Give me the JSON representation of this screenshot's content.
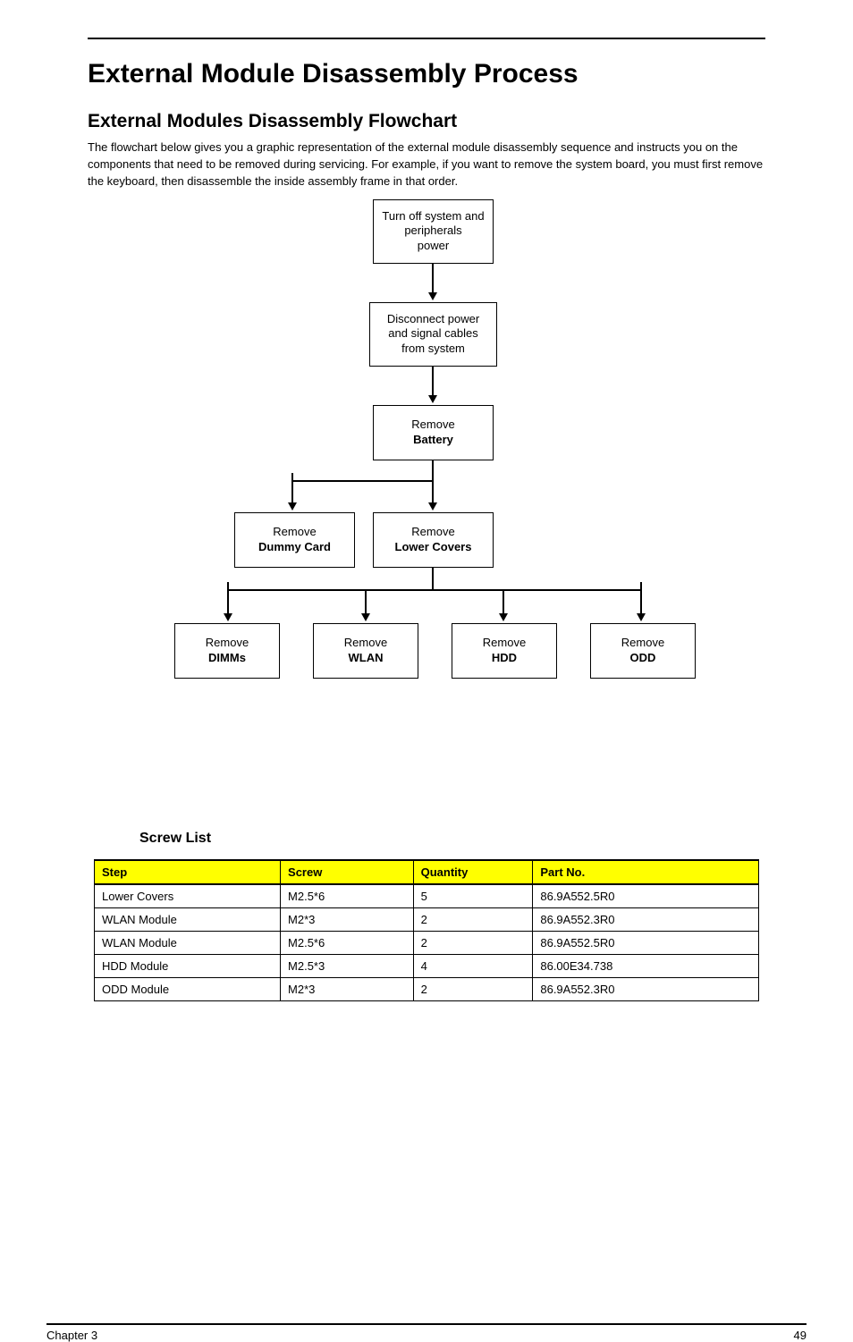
{
  "page": {
    "heading1": "External Module Disassembly Process",
    "heading2": "External Modules Disassembly Flowchart",
    "intro": "The flowchart below gives you a graphic representation of the external module disassembly sequence and instructs you on the components that need to be removed during servicing. For example, if you want to remove the system board, you must first remove the keyboard, then disassemble the inside assembly frame in that order."
  },
  "flow": {
    "box1": {
      "l1": "Turn off system and peripherals",
      "l2": "power"
    },
    "box2": {
      "l1": "Disconnect power and signal cables",
      "l2": "from system"
    },
    "box3": {
      "l1": "Remove",
      "l2": "Battery"
    },
    "box4": {
      "l1": "Remove",
      "l2": "Dummy Card"
    },
    "box5": {
      "l1": "Remove",
      "l2": "Lower Covers"
    },
    "box6": {
      "l1": "Remove",
      "l2": "DIMMs"
    },
    "box7": {
      "l1": "Remove",
      "l2": "WLAN"
    },
    "box8": {
      "l1": "Remove",
      "l2": "HDD"
    },
    "box9": {
      "l1": "Remove",
      "l2": "ODD"
    }
  },
  "table": {
    "title": "Screw List",
    "headers": [
      "Step",
      "Screw",
      "Quantity",
      "Part No."
    ],
    "rows": [
      [
        "Lower Covers",
        "M2.5*6",
        "5",
        "86.9A552.5R0"
      ],
      [
        "WLAN Module",
        "M2*3",
        "2",
        "86.9A552.3R0"
      ],
      [
        "WLAN Module",
        "M2.5*6",
        "2",
        "86.9A552.5R0"
      ],
      [
        "HDD Module",
        "M2.5*3",
        "4",
        "86.00E34.738"
      ],
      [
        "ODD Module",
        "M2*3",
        "2",
        "86.9A552.3R0"
      ]
    ]
  },
  "footer": {
    "left": "Chapter 3",
    "right": "49"
  }
}
